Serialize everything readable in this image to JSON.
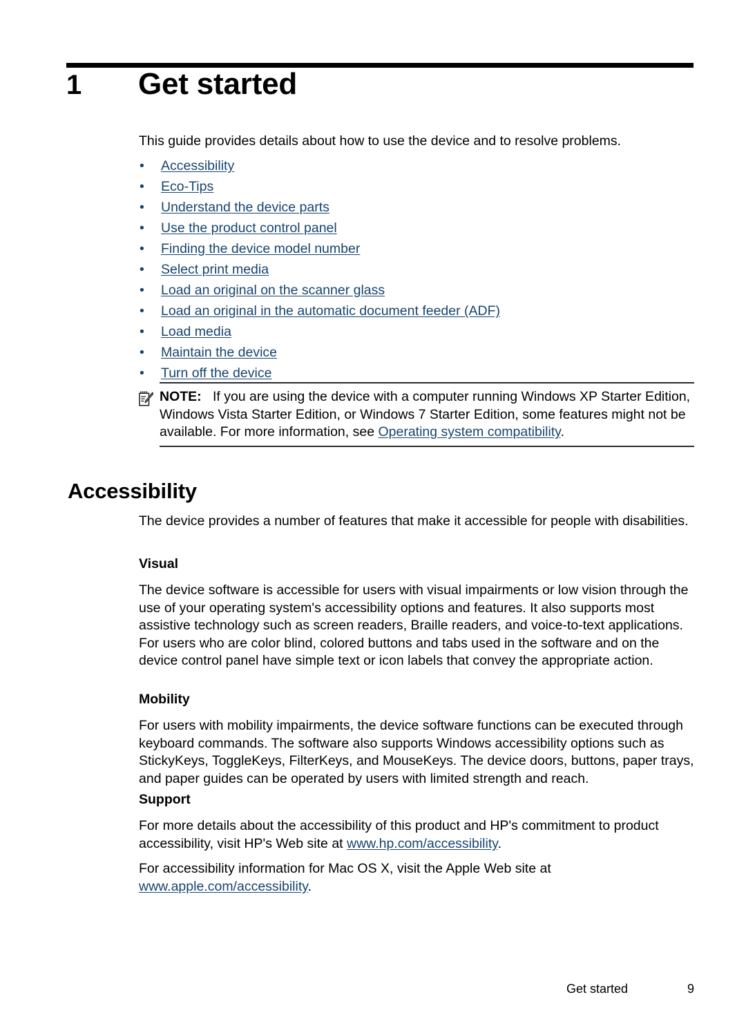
{
  "chapter": {
    "number": "1",
    "title": "Get started",
    "intro": "This guide provides details about how to use the device and to resolve problems."
  },
  "toc_links": [
    {
      "bullet": "•",
      "label": "Accessibility"
    },
    {
      "bullet": "•",
      "label": "Eco-Tips"
    },
    {
      "bullet": "•",
      "label": "Understand the device parts"
    },
    {
      "bullet": "•",
      "label": "Use the product control panel"
    },
    {
      "bullet": "•",
      "label": "Finding the device model number"
    },
    {
      "bullet": "•",
      "label": "Select print media"
    },
    {
      "bullet": "•",
      "label": "Load an original on the scanner glass"
    },
    {
      "bullet": "•",
      "label": "Load an original in the automatic document feeder (ADF)"
    },
    {
      "bullet": "•",
      "label": "Load media"
    },
    {
      "bullet": "•",
      "label": "Maintain the device"
    },
    {
      "bullet": "•",
      "label": "Turn off the device"
    }
  ],
  "note": {
    "icon": "note-pencil-icon",
    "label": "NOTE:",
    "text_before_link": "If you are using the device with a computer running Windows XP Starter Edition, Windows Vista Starter Edition, or Windows 7 Starter Edition, some features might not be available. For more information, see ",
    "link": "Operating system compatibility",
    "text_after_link": "."
  },
  "section": {
    "heading": "Accessibility",
    "intro": "The device provides a number of features that make it accessible for people with disabilities.",
    "subsections": [
      {
        "heading": "Visual",
        "paragraph": "The device software is accessible for users with visual impairments or low vision through the use of your operating system's accessibility options and features. It also supports most assistive technology such as screen readers, Braille readers, and voice-to-text applications. For users who are color blind, colored buttons and tabs used in the software and on the device control panel have simple text or icon labels that convey the appropriate action."
      },
      {
        "heading": "Mobility",
        "paragraph": "For users with mobility impairments, the device software functions can be executed through keyboard commands. The software also supports Windows accessibility options such as StickyKeys, ToggleKeys, FilterKeys, and MouseKeys. The device doors, buttons, paper trays, and paper guides can be operated by users with limited strength and reach."
      }
    ],
    "support": {
      "heading": "Support",
      "para1_before": "For more details about the accessibility of this product and HP's commitment to product accessibility, visit HP's Web site at ",
      "para1_link": "www.hp.com/accessibility",
      "para1_after": ".",
      "para2_before": "For accessibility information for Mac OS X, visit the Apple Web site at ",
      "para2_link": "www.apple.com/accessibility",
      "para2_after": "."
    }
  },
  "footer": {
    "title": "Get started",
    "page_number": "9"
  },
  "colors": {
    "link": "#16446e",
    "text": "#000000",
    "rule": "#000000"
  }
}
